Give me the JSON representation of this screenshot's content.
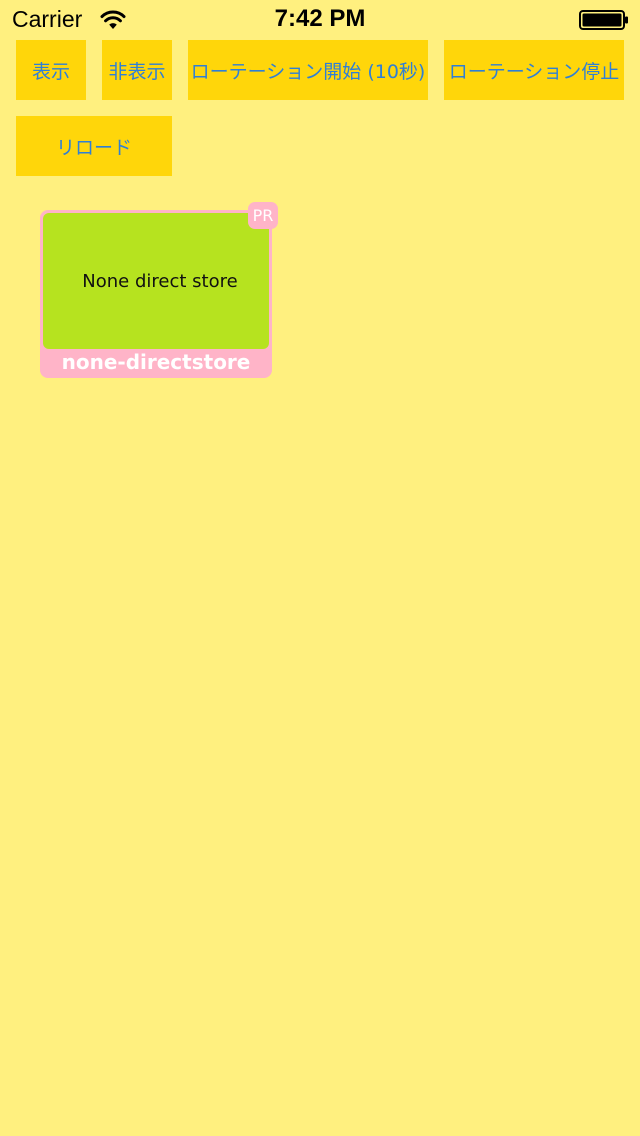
{
  "status_bar": {
    "carrier": "Carrier",
    "time": "7:42 PM",
    "wifi_icon": "wifi-icon",
    "battery_icon": "battery-full-icon"
  },
  "buttons": {
    "show": "表示",
    "hide": "非表示",
    "rotation_start": "ローテーション開始 (10秒)",
    "rotation_stop": "ローテーション停止",
    "reload": "リロード"
  },
  "ad": {
    "badge": "PR",
    "creative_text": "None direct store",
    "caption": "none-directstore"
  },
  "colors": {
    "background": "#fff07f",
    "button_bg": "#ffd60a",
    "button_text": "#2f7fd6",
    "ad_frame": "#ffb4c8",
    "ad_creative": "#b6e31f"
  }
}
